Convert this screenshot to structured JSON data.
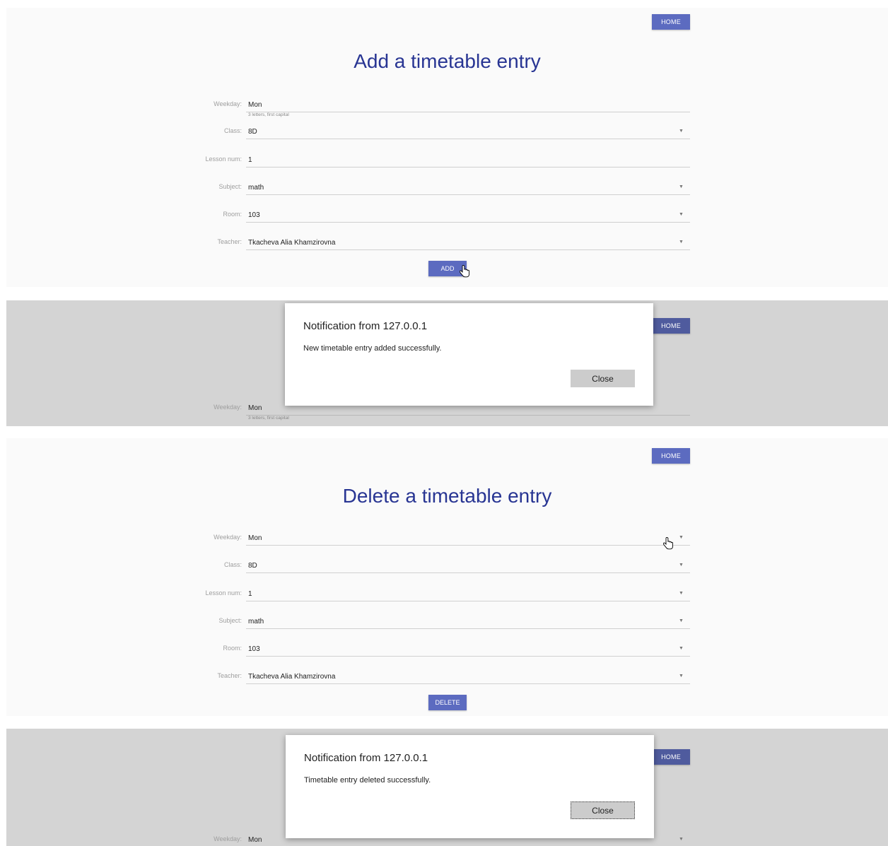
{
  "add_form": {
    "home_label": "HOME",
    "title": "Add a timetable entry",
    "fields": [
      {
        "label": "Weekday:",
        "value": "Mon",
        "hint": "3 letters, first capital"
      },
      {
        "label": "Class:",
        "value": "8D"
      },
      {
        "label": "Lesson num:",
        "value": "1"
      },
      {
        "label": "Subject:",
        "value": "math"
      },
      {
        "label": "Room:",
        "value": "103"
      },
      {
        "label": "Teacher:",
        "value": "Tkacheva Alia Khamzirovna"
      }
    ],
    "submit_label": "ADD"
  },
  "add_notification": {
    "home_label": "HOME",
    "title": "Notification from 127.0.0.1",
    "message": "New timetable entry added successfully.",
    "close_label": "Close",
    "weekday_label": "Weekday:",
    "weekday_value": "Mon",
    "weekday_hint": "3 letters, first capital"
  },
  "delete_form": {
    "home_label": "HOME",
    "title": "Delete a timetable entry",
    "fields": [
      {
        "label": "Weekday:",
        "value": "Mon"
      },
      {
        "label": "Class:",
        "value": "8D"
      },
      {
        "label": "Lesson num:",
        "value": "1"
      },
      {
        "label": "Subject:",
        "value": "math"
      },
      {
        "label": "Room:",
        "value": "103"
      },
      {
        "label": "Teacher:",
        "value": "Tkacheva Alia Khamzirovna"
      }
    ],
    "submit_label": "DELETE"
  },
  "delete_notification": {
    "home_label": "HOME",
    "title": "Notification from 127.0.0.1",
    "message": "Timetable entry deleted successfully.",
    "close_label": "Close",
    "weekday_label": "Weekday:",
    "weekday_value": "Mon"
  },
  "colors": {
    "primary": "#5c6bc0",
    "title": "#283593",
    "page_bg": "#fafafa",
    "overlay_bg": "#d4d4d4"
  },
  "icons": {
    "dropdown": "triangle-down",
    "cursor": "hand-pointer"
  }
}
